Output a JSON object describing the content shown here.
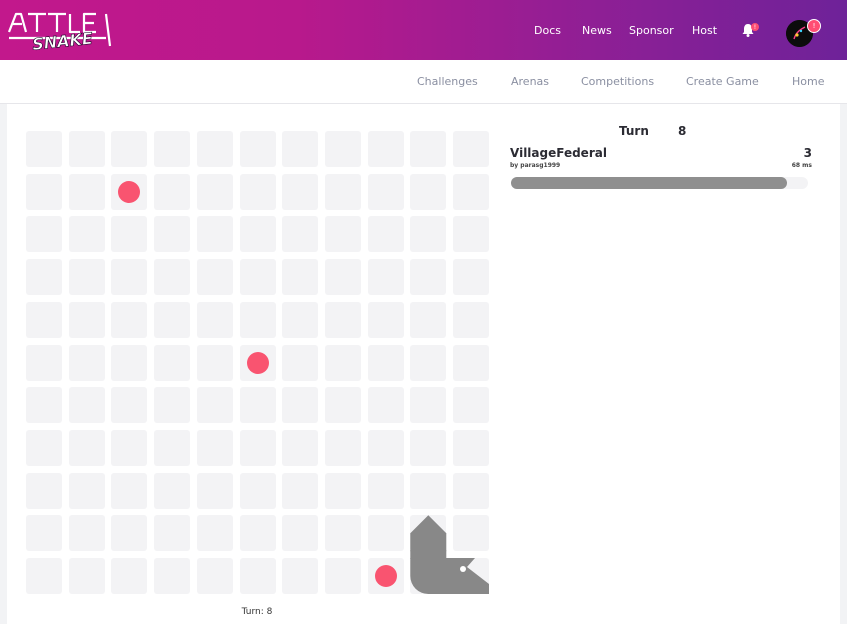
{
  "header": {
    "logo_text": "BATTLESNAKE",
    "nav": [
      {
        "label": "Docs"
      },
      {
        "label": "News"
      },
      {
        "label": "Sponsor"
      },
      {
        "label": "Host"
      }
    ],
    "notification_badge": "!",
    "profile_badge": "!"
  },
  "subnav": {
    "items": [
      {
        "label": "Challenges"
      },
      {
        "label": "Arenas"
      },
      {
        "label": "Competitions"
      },
      {
        "label": "Create Game"
      },
      {
        "label": "Home"
      }
    ]
  },
  "game": {
    "board": {
      "width": 11,
      "height": 11
    },
    "food": [
      {
        "col": 2,
        "row": 1
      },
      {
        "col": 5,
        "row": 5
      },
      {
        "col": 8,
        "row": 10
      }
    ],
    "snake": {
      "color": "#888888",
      "body": [
        [
          9,
          9
        ],
        [
          9,
          10
        ],
        [
          10,
          10
        ]
      ]
    },
    "turn_caption": "Turn: 8"
  },
  "scoreboard": {
    "turn_label": "Turn",
    "turn_value": "8",
    "snakes": [
      {
        "name": "VillageFederal",
        "author": "by parasg1999",
        "length": "3",
        "latency": "68 ms",
        "health": 0.93,
        "color": "#8f8f8f"
      }
    ]
  },
  "colors": {
    "header_gradient_start": "#c2188c",
    "header_gradient_end": "#6e2299",
    "food": "#f95470",
    "cell": "#f3f3f5"
  }
}
